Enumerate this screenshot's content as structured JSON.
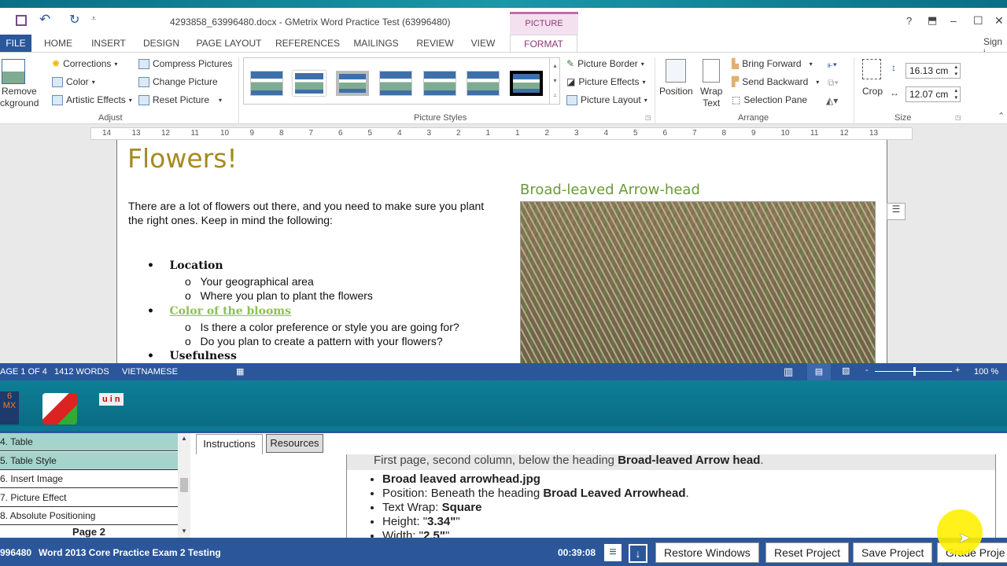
{
  "window": {
    "title": "4293858_63996480.docx -  GMetrix Word Practice Test (63996480)",
    "context_tab_group": "PICTURE TOOLS",
    "sign_in": "Sign i",
    "controls": {
      "help": "?",
      "ribbon_options": "⬒",
      "minimize": "–",
      "maximize": "☐",
      "close": "✕"
    }
  },
  "tabs": [
    "FILE",
    "HOME",
    "INSERT",
    "DESIGN",
    "PAGE LAYOUT",
    "REFERENCES",
    "MAILINGS",
    "REVIEW",
    "VIEW",
    "FORMAT"
  ],
  "active_tab": "FORMAT",
  "ribbon": {
    "adjust": {
      "label": "Adjust",
      "remove_background": [
        "Remove",
        "ckground"
      ],
      "corrections": "Corrections",
      "color": "Color",
      "artistic_effects": "Artistic Effects",
      "compress_pictures": "Compress Pictures",
      "change_picture": "Change Picture",
      "reset_picture": "Reset Picture"
    },
    "picture_styles": {
      "label": "Picture Styles",
      "picture_border": "Picture Border",
      "picture_effects": "Picture Effects",
      "picture_layout": "Picture Layout"
    },
    "arrange": {
      "label": "Arrange",
      "position": "Position",
      "wrap_text": [
        "Wrap",
        "Text"
      ],
      "bring_forward": "Bring Forward",
      "send_backward": "Send Backward",
      "selection_pane": "Selection Pane"
    },
    "size": {
      "label": "Size",
      "crop": "Crop",
      "height": "16.13 cm",
      "width": "12.07 cm"
    }
  },
  "ruler": {
    "ticks": [
      "14",
      "13",
      "12",
      "11",
      "10",
      "9",
      "8",
      "7",
      "6",
      "5",
      "4",
      "3",
      "2",
      "1",
      "1",
      "2",
      "3",
      "4",
      "5",
      "6",
      "7",
      "8",
      "9",
      "10",
      "11",
      "12",
      "13"
    ]
  },
  "document": {
    "title": "Flowers!",
    "intro": "There are a lot of flowers out there, and you need to make sure you plant the right ones. Keep in mind the following:",
    "list": [
      {
        "label": "Location",
        "sub": [
          "Your geographical area",
          "Where you plan to plant the flowers"
        ]
      },
      {
        "label": "Color of the blooms",
        "sub": [
          "Is there a color preference or style you are going for?",
          "Do you plan to create a pattern with your flowers?"
        ]
      },
      {
        "label": "Usefulness",
        "sub": []
      }
    ],
    "image_heading": "Broad-leaved Arrow-head"
  },
  "status": {
    "page": "AGE 1 OF 4",
    "words": "1412 WORDS",
    "language": "VIETNAMESE",
    "zoom": "100 %",
    "zoom_level_percent": 100
  },
  "desktop_icons": [
    "6 MX",
    "Foxit",
    "u i n"
  ],
  "tasks": {
    "items": [
      {
        "label": "4. Table",
        "completed": true
      },
      {
        "label": "5. Table Style",
        "completed": true
      },
      {
        "label": "6. Insert Image",
        "completed": false
      },
      {
        "label": "7. Picture Effect",
        "completed": false
      },
      {
        "label": "8. Absolute Positioning",
        "completed": false
      }
    ],
    "page_header": "Page 2"
  },
  "instructions": {
    "tabs": [
      "Instructions",
      "Resources"
    ],
    "heading_pre": "First page, second column, below the heading ",
    "heading_bold": "Broad-leaved Arrow head",
    "bullets": [
      {
        "pre": "",
        "bold": "Broad leaved arrowhead.jpg",
        "post": ""
      },
      {
        "pre": "Position: Beneath the heading ",
        "bold": "Broad Leaved Arrowhead",
        "post": "."
      },
      {
        "pre": "Text Wrap: ",
        "bold": "Square",
        "post": ""
      },
      {
        "pre": "Height: \"",
        "bold": "3.34\"",
        "post": "\""
      },
      {
        "pre": "Width: \"",
        "bold": "2.5\"",
        "post": "\""
      }
    ]
  },
  "bottom_bar": {
    "exam_id": "996480",
    "exam_name": "Word 2013 Core Practice Exam 2 Testing",
    "timer": "00:39:08",
    "buttons": [
      "Restore Windows",
      "Reset Project",
      "Save Project",
      "Grade Proje"
    ]
  },
  "colors": {
    "word_blue": "#2b579a",
    "title_gold": "#a68a1f",
    "link_green": "#8cc152",
    "heading_green": "#6a9b3a",
    "task_done": "#a4d4cc",
    "picture_tools_pink": "#f4e1ef"
  }
}
